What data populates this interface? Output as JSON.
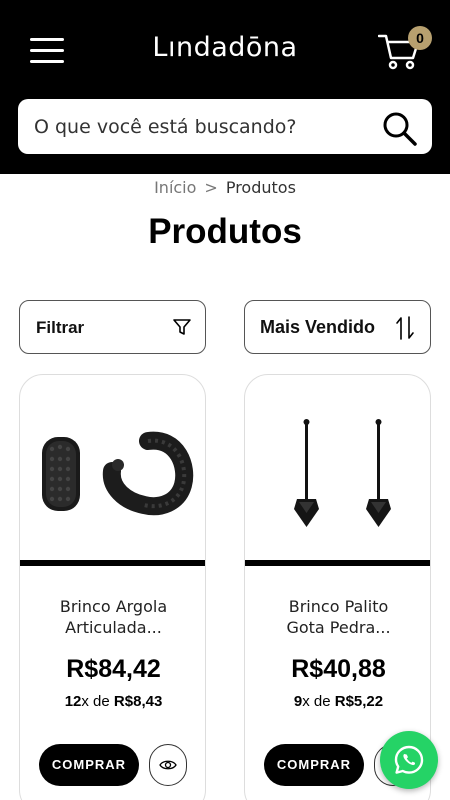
{
  "header": {
    "logo": "Lındadōna",
    "cart_count": "0"
  },
  "search": {
    "placeholder": "O que você está buscando?"
  },
  "breadcrumb": {
    "home": "Início",
    "separator": ">",
    "current": "Produtos"
  },
  "page_title": "Produtos",
  "toolbar": {
    "filter_label": "Filtrar",
    "sort_label": "Mais Vendido"
  },
  "products": [
    {
      "name_line1": "Brinco Argola",
      "name_line2": "Articulada...",
      "price": "R$84,42",
      "installments_count": "12",
      "installments_of": "x de ",
      "installment_value": "R$8,43",
      "buy_label": "COMPRAR"
    },
    {
      "name_line1": "Brinco Palito",
      "name_line2": "Gota Pedra...",
      "price": "R$40,88",
      "installments_count": "9",
      "installments_of": "x de ",
      "installment_value": "R$5,22",
      "buy_label": "COMPRAR"
    }
  ],
  "colors": {
    "header_bg": "#000000",
    "badge": "#b7a06f",
    "whatsapp": "#25d366"
  }
}
